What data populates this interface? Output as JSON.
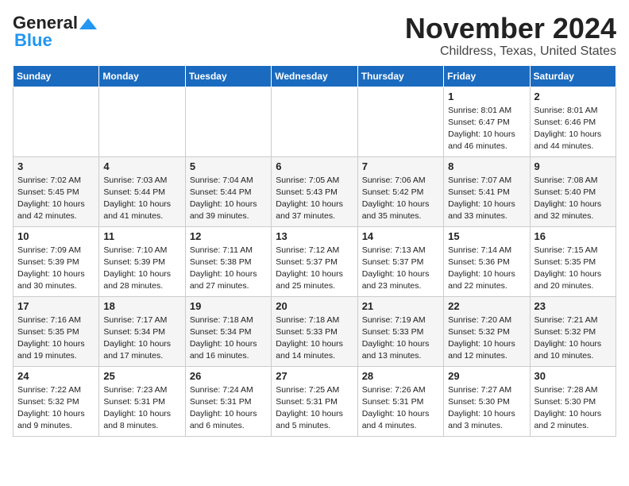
{
  "logo": {
    "general": "General",
    "blue": "Blue"
  },
  "title": "November 2024",
  "location": "Childress, Texas, United States",
  "days_header": [
    "Sunday",
    "Monday",
    "Tuesday",
    "Wednesday",
    "Thursday",
    "Friday",
    "Saturday"
  ],
  "weeks": [
    [
      {
        "day": "",
        "info": ""
      },
      {
        "day": "",
        "info": ""
      },
      {
        "day": "",
        "info": ""
      },
      {
        "day": "",
        "info": ""
      },
      {
        "day": "",
        "info": ""
      },
      {
        "day": "1",
        "info": "Sunrise: 8:01 AM\nSunset: 6:47 PM\nDaylight: 10 hours\nand 46 minutes."
      },
      {
        "day": "2",
        "info": "Sunrise: 8:01 AM\nSunset: 6:46 PM\nDaylight: 10 hours\nand 44 minutes."
      }
    ],
    [
      {
        "day": "3",
        "info": "Sunrise: 7:02 AM\nSunset: 5:45 PM\nDaylight: 10 hours\nand 42 minutes."
      },
      {
        "day": "4",
        "info": "Sunrise: 7:03 AM\nSunset: 5:44 PM\nDaylight: 10 hours\nand 41 minutes."
      },
      {
        "day": "5",
        "info": "Sunrise: 7:04 AM\nSunset: 5:44 PM\nDaylight: 10 hours\nand 39 minutes."
      },
      {
        "day": "6",
        "info": "Sunrise: 7:05 AM\nSunset: 5:43 PM\nDaylight: 10 hours\nand 37 minutes."
      },
      {
        "day": "7",
        "info": "Sunrise: 7:06 AM\nSunset: 5:42 PM\nDaylight: 10 hours\nand 35 minutes."
      },
      {
        "day": "8",
        "info": "Sunrise: 7:07 AM\nSunset: 5:41 PM\nDaylight: 10 hours\nand 33 minutes."
      },
      {
        "day": "9",
        "info": "Sunrise: 7:08 AM\nSunset: 5:40 PM\nDaylight: 10 hours\nand 32 minutes."
      }
    ],
    [
      {
        "day": "10",
        "info": "Sunrise: 7:09 AM\nSunset: 5:39 PM\nDaylight: 10 hours\nand 30 minutes."
      },
      {
        "day": "11",
        "info": "Sunrise: 7:10 AM\nSunset: 5:39 PM\nDaylight: 10 hours\nand 28 minutes."
      },
      {
        "day": "12",
        "info": "Sunrise: 7:11 AM\nSunset: 5:38 PM\nDaylight: 10 hours\nand 27 minutes."
      },
      {
        "day": "13",
        "info": "Sunrise: 7:12 AM\nSunset: 5:37 PM\nDaylight: 10 hours\nand 25 minutes."
      },
      {
        "day": "14",
        "info": "Sunrise: 7:13 AM\nSunset: 5:37 PM\nDaylight: 10 hours\nand 23 minutes."
      },
      {
        "day": "15",
        "info": "Sunrise: 7:14 AM\nSunset: 5:36 PM\nDaylight: 10 hours\nand 22 minutes."
      },
      {
        "day": "16",
        "info": "Sunrise: 7:15 AM\nSunset: 5:35 PM\nDaylight: 10 hours\nand 20 minutes."
      }
    ],
    [
      {
        "day": "17",
        "info": "Sunrise: 7:16 AM\nSunset: 5:35 PM\nDaylight: 10 hours\nand 19 minutes."
      },
      {
        "day": "18",
        "info": "Sunrise: 7:17 AM\nSunset: 5:34 PM\nDaylight: 10 hours\nand 17 minutes."
      },
      {
        "day": "19",
        "info": "Sunrise: 7:18 AM\nSunset: 5:34 PM\nDaylight: 10 hours\nand 16 minutes."
      },
      {
        "day": "20",
        "info": "Sunrise: 7:18 AM\nSunset: 5:33 PM\nDaylight: 10 hours\nand 14 minutes."
      },
      {
        "day": "21",
        "info": "Sunrise: 7:19 AM\nSunset: 5:33 PM\nDaylight: 10 hours\nand 13 minutes."
      },
      {
        "day": "22",
        "info": "Sunrise: 7:20 AM\nSunset: 5:32 PM\nDaylight: 10 hours\nand 12 minutes."
      },
      {
        "day": "23",
        "info": "Sunrise: 7:21 AM\nSunset: 5:32 PM\nDaylight: 10 hours\nand 10 minutes."
      }
    ],
    [
      {
        "day": "24",
        "info": "Sunrise: 7:22 AM\nSunset: 5:32 PM\nDaylight: 10 hours\nand 9 minutes."
      },
      {
        "day": "25",
        "info": "Sunrise: 7:23 AM\nSunset: 5:31 PM\nDaylight: 10 hours\nand 8 minutes."
      },
      {
        "day": "26",
        "info": "Sunrise: 7:24 AM\nSunset: 5:31 PM\nDaylight: 10 hours\nand 6 minutes."
      },
      {
        "day": "27",
        "info": "Sunrise: 7:25 AM\nSunset: 5:31 PM\nDaylight: 10 hours\nand 5 minutes."
      },
      {
        "day": "28",
        "info": "Sunrise: 7:26 AM\nSunset: 5:31 PM\nDaylight: 10 hours\nand 4 minutes."
      },
      {
        "day": "29",
        "info": "Sunrise: 7:27 AM\nSunset: 5:30 PM\nDaylight: 10 hours\nand 3 minutes."
      },
      {
        "day": "30",
        "info": "Sunrise: 7:28 AM\nSunset: 5:30 PM\nDaylight: 10 hours\nand 2 minutes."
      }
    ]
  ]
}
